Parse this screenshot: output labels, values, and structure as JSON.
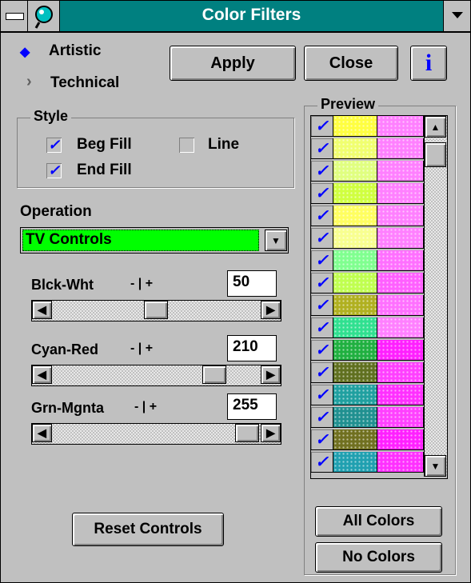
{
  "window": {
    "title": "Color Filters"
  },
  "mode": {
    "artistic": "Artistic",
    "technical": "Technical",
    "selected": "artistic"
  },
  "buttons": {
    "apply": "Apply",
    "close": "Close",
    "info": "i",
    "reset": "Reset Controls",
    "all_colors": "All Colors",
    "no_colors": "No Colors"
  },
  "style": {
    "title": "Style",
    "beg_fill": {
      "label": "Beg Fill",
      "checked": true
    },
    "line": {
      "label": "Line",
      "checked": false
    },
    "end_fill": {
      "label": "End Fill",
      "checked": true
    }
  },
  "operation": {
    "label": "Operation",
    "value": "TV Controls",
    "color": "#00ff00"
  },
  "sliders": [
    {
      "label": "Blck-Wht",
      "value": "50",
      "range_hint": "- | +",
      "position": 0.5
    },
    {
      "label": "Cyan-Red",
      "value": "210",
      "range_hint": "- | +",
      "position": 0.82
    },
    {
      "label": "Grn-Mgnta",
      "value": "255",
      "range_hint": "- | +",
      "position": 1.0
    }
  ],
  "preview": {
    "title": "Preview",
    "rows": [
      {
        "checked": true,
        "c1": "#ffff40",
        "c2": "#ff80ff"
      },
      {
        "checked": true,
        "c1": "#f0ff70",
        "c2": "#ff80ff"
      },
      {
        "checked": true,
        "c1": "#e0ff80",
        "c2": "#ff80ff"
      },
      {
        "checked": true,
        "c1": "#d0ff40",
        "c2": "#ff80ff"
      },
      {
        "checked": true,
        "c1": "#ffff60",
        "c2": "#ff80ff"
      },
      {
        "checked": true,
        "c1": "#f8ff90",
        "c2": "#ff80ff"
      },
      {
        "checked": true,
        "c1": "#80ff90",
        "c2": "#ff70ff"
      },
      {
        "checked": true,
        "c1": "#c0ff50",
        "c2": "#ff60ff"
      },
      {
        "checked": true,
        "c1": "#b0b020",
        "c2": "#ff70ff"
      },
      {
        "checked": true,
        "c1": "#30e090",
        "c2": "#ff80ff"
      },
      {
        "checked": true,
        "c1": "#20b040",
        "c2": "#ff20ff"
      },
      {
        "checked": true,
        "c1": "#607020",
        "c2": "#ff40ff"
      },
      {
        "checked": true,
        "c1": "#20a0a0",
        "c2": "#ff30ff"
      },
      {
        "checked": true,
        "c1": "#209090",
        "c2": "#ff40ff"
      },
      {
        "checked": true,
        "c1": "#707020",
        "c2": "#ff20ff"
      },
      {
        "checked": true,
        "c1": "#20a0b0",
        "c2": "#ff30ff"
      }
    ]
  }
}
